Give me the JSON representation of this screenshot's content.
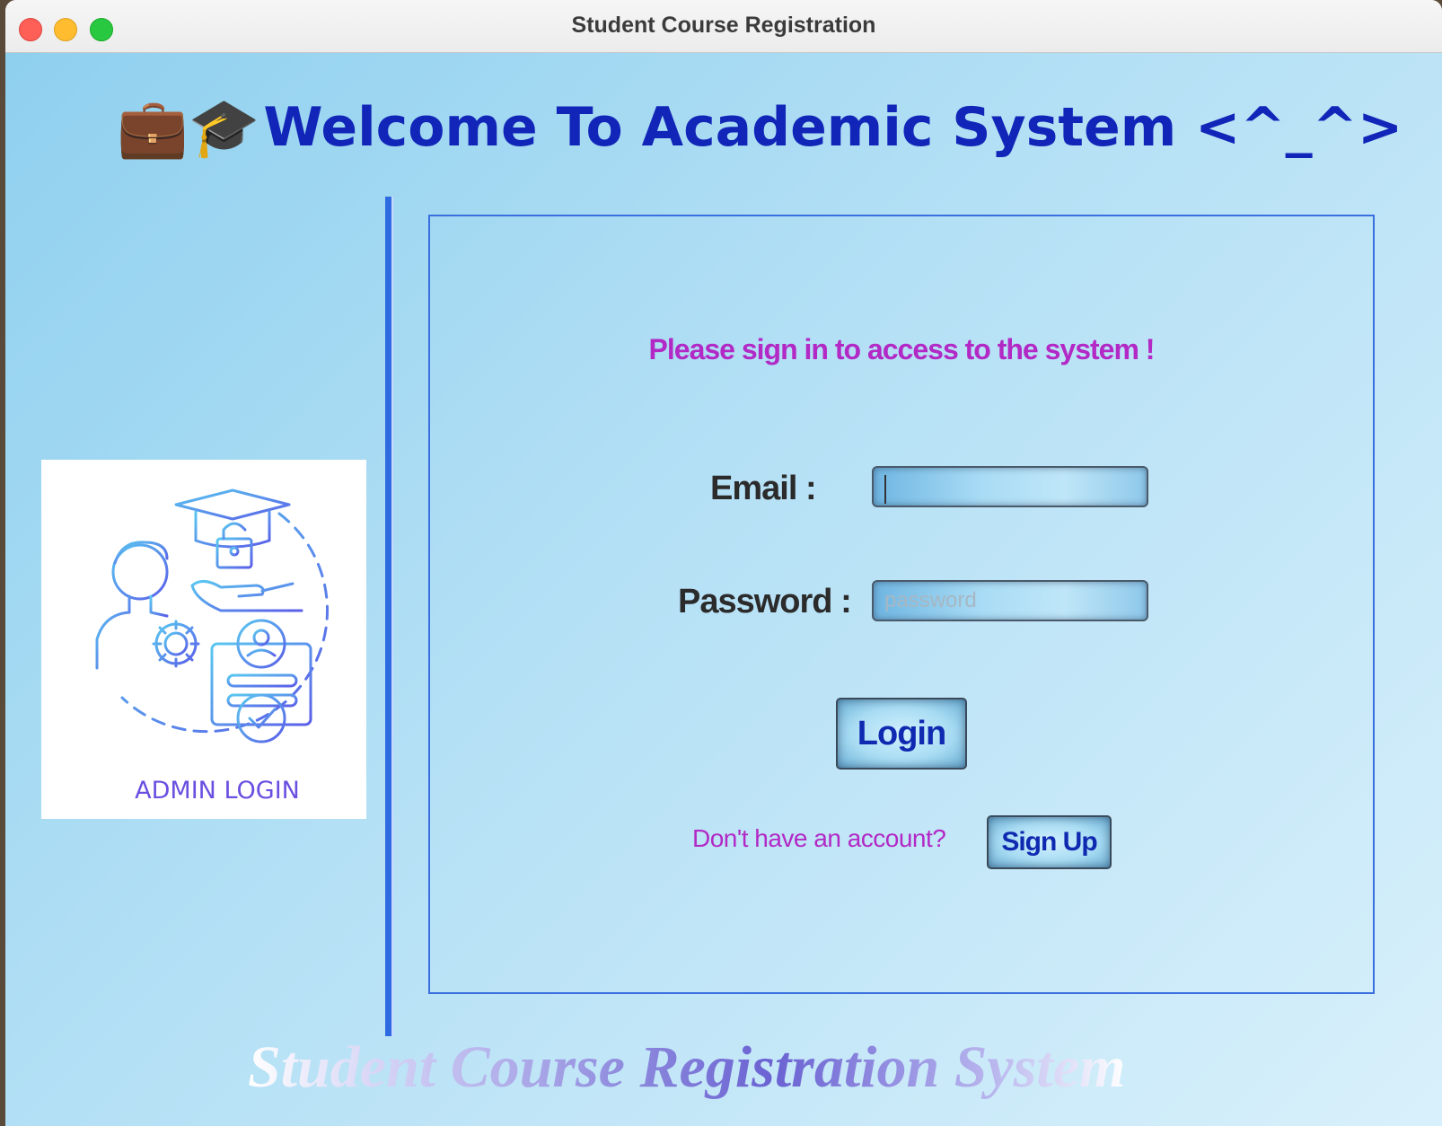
{
  "window": {
    "title": "Student Course Registration"
  },
  "header": {
    "icons": "💼🎓",
    "icon_names": [
      "briefcase-icon",
      "graduation-cap-icon"
    ],
    "welcome_text": "Welcome To Academic System  <^_^>"
  },
  "admin_card": {
    "label": "ADMIN LOGIN"
  },
  "login_panel": {
    "prompt": "Please sign in to access to the system !",
    "email_label": "Email :",
    "email_value": "",
    "password_label": "Password :",
    "password_placeholder": "password",
    "login_button": "Login",
    "no_account_text": "Don't have an account?",
    "signup_button": "Sign Up"
  },
  "footer": {
    "title": "Student Course Registration System"
  },
  "colors": {
    "accent_blue": "#1126b8",
    "prompt_magenta": "#b229c6",
    "panel_border": "#3a6fe0"
  }
}
